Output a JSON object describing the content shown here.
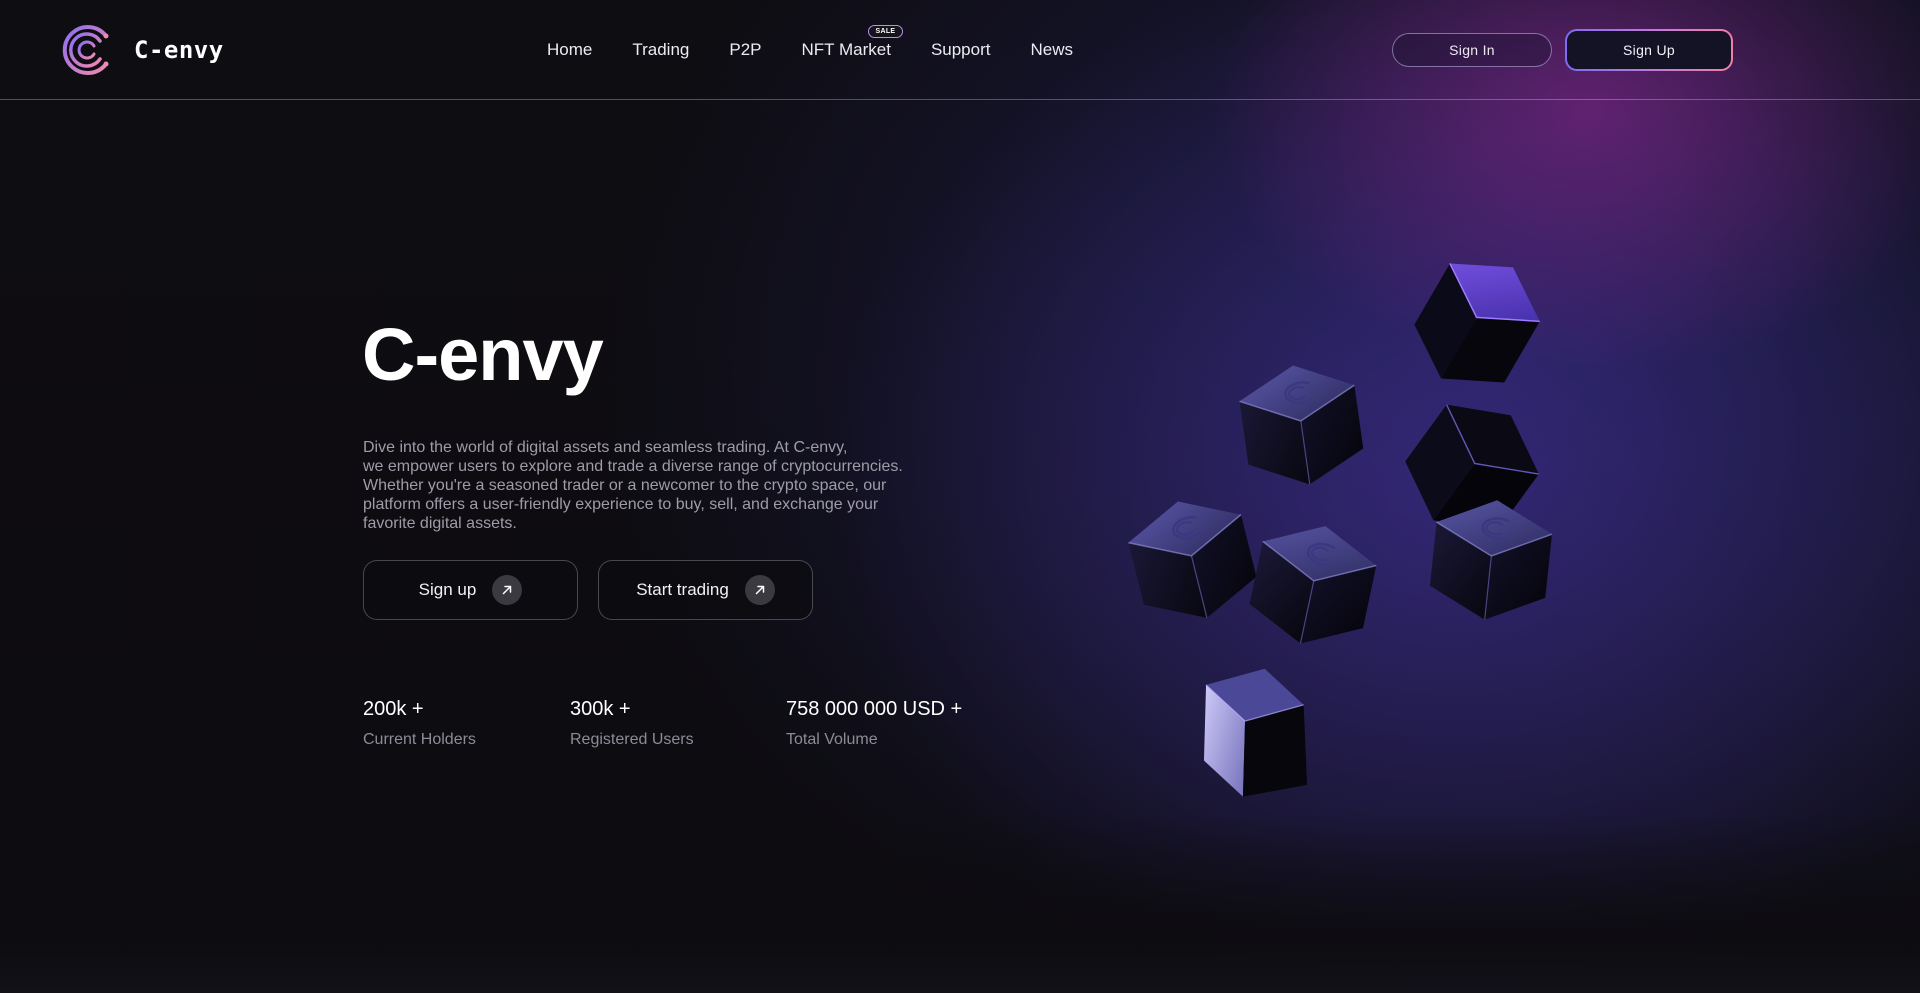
{
  "brand": {
    "name": "C-envy"
  },
  "nav": {
    "items": [
      {
        "label": "Home"
      },
      {
        "label": "Trading"
      },
      {
        "label": "P2P"
      },
      {
        "label": "NFT Market",
        "badge": "SALE"
      },
      {
        "label": "Support"
      },
      {
        "label": "News"
      }
    ]
  },
  "auth": {
    "sign_in": "Sign In",
    "sign_up": "Sign Up"
  },
  "hero": {
    "title": "C-envy",
    "description_lines": [
      "Dive into the world of digital assets and seamless trading. At C-envy,",
      "we empower users to explore and trade a diverse range of cryptocurrencies.",
      "Whether you're a seasoned trader or a newcomer to the crypto space, our",
      "platform offers a user-friendly experience to buy, sell, and exchange your",
      "favorite digital assets."
    ],
    "cta_primary": "Sign up",
    "cta_secondary": "Start trading"
  },
  "stats": [
    {
      "value": "200k +",
      "label": "Current Holders"
    },
    {
      "value": "300k +",
      "label": "Registered Users"
    },
    {
      "value": "758 000 000 USD +",
      "label": "Total Volume"
    }
  ],
  "colors": {
    "background": "#0d0c10",
    "accent_purple": "#7d6cf2",
    "accent_pink": "#f07fa8",
    "muted_text": "#9f9ca8"
  },
  "icons": {
    "cta_arrow": "arrow-up-right-icon",
    "logo": "c-envy-logo-icon"
  }
}
